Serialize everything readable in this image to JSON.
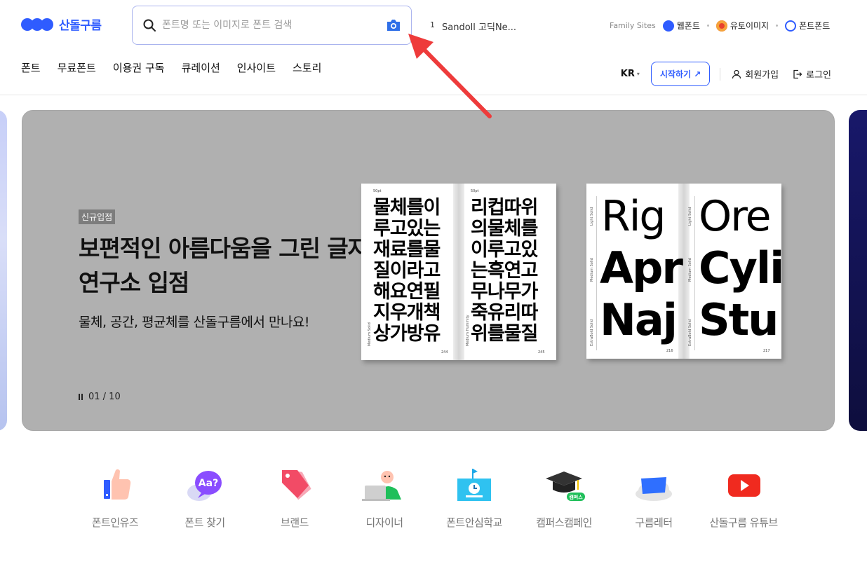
{
  "logo": {
    "text": "산돌구름"
  },
  "search": {
    "placeholder": "폰트명 또는 이미지로 폰트 검색"
  },
  "trending": {
    "rank": "1",
    "text": "Sandoll 고딕Ne..."
  },
  "family_sites": {
    "label": "Family Sites",
    "sites": [
      {
        "name": "웹폰트",
        "color": "#2f5cff"
      },
      {
        "name": "유토이미지",
        "color": "#e8412c"
      },
      {
        "name": "폰트폰트",
        "color": "#2f5cff"
      }
    ]
  },
  "nav": {
    "items": [
      "폰트",
      "무료폰트",
      "이용권 구독",
      "큐레이션",
      "인사이트",
      "스토리"
    ],
    "lang": "KR",
    "start_label": "시작하기 ↗",
    "signup": "회원가입",
    "login": "로그인"
  },
  "banner": {
    "badge": "신규입점",
    "headline": "보편적인 아름다움을 그린 글자연구소 입점",
    "subline": "물체, 공간, 평균체를 산돌구름에서 만나요!",
    "pager": "01 / 10",
    "book1": {
      "left_pt": "50pt",
      "left_lines": [
        "물체를이",
        "루고있는",
        "재료를물",
        "질이라고",
        "해요연필",
        "지우개책",
        "상가방유"
      ],
      "left_side": "Medium Solid",
      "left_page": "244",
      "right_pt": "50pt",
      "right_lines": [
        "리컵따위",
        "의물체를",
        "이루고있",
        "는흑연고",
        "무나무가",
        "죽유리따",
        "위를물질"
      ],
      "right_side": "Medium Hummity",
      "right_page": "245"
    },
    "book2": {
      "left_words": [
        "Rig",
        "Apr",
        "Naj"
      ],
      "right_words": [
        "Ore",
        "Cyli",
        "Stu"
      ],
      "side_labels": [
        "Light Solid",
        "Medium Solid",
        "ExtraBold Solid"
      ],
      "left_page": "216",
      "right_page": "217"
    }
  },
  "categories": [
    {
      "label": "폰트인유즈",
      "icon": "thumbs-up-icon"
    },
    {
      "label": "폰트 찾기",
      "icon": "speech-bubble-aa-icon"
    },
    {
      "label": "브랜드",
      "icon": "tag-icon"
    },
    {
      "label": "디자이너",
      "icon": "designer-laptop-icon"
    },
    {
      "label": "폰트안심학교",
      "icon": "school-clock-icon"
    },
    {
      "label": "캠퍼스캠페인",
      "icon": "graduation-cap-icon",
      "badge": "캠퍼스"
    },
    {
      "label": "구름레터",
      "icon": "cloud-letter-icon"
    },
    {
      "label": "산돌구름 유튜브",
      "icon": "youtube-icon"
    }
  ],
  "colors": {
    "brand": "#2f5cff",
    "banner_bg": "#b0b0b0",
    "annotation_arrow": "#ee3b3b"
  }
}
